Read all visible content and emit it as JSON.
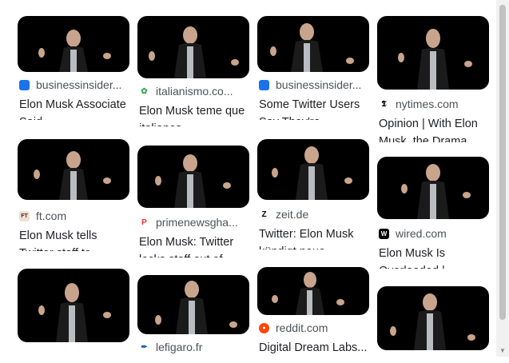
{
  "results": [
    {
      "source": "businessinsider...",
      "title": "Elon Musk Associate Said...",
      "favicon": "bi-icon",
      "favicon_color": "#1a73e8"
    },
    {
      "source": "italianismo.co...",
      "title": "Elon Musk teme que italianos...",
      "favicon": "it-leaf-icon",
      "favicon_color": "#34a853"
    },
    {
      "source": "businessinsider...",
      "title": "Some Twitter Users Say They're...",
      "favicon": "bi-icon",
      "favicon_color": "#1a73e8"
    },
    {
      "source": "nytimes.com",
      "title": "Opinion | With Elon Musk, the Drama...",
      "favicon": "nyt-icon",
      "favicon_color": "#000000"
    },
    {
      "source": "ft.com",
      "title": "Elon Musk tells Twitter staff to...",
      "favicon": "ft-icon",
      "favicon_color": "#f2dfce"
    },
    {
      "source": "primenewsgha...",
      "title": "Elon Musk: Twitter locks staff out of...",
      "favicon": "pn-icon",
      "favicon_color": "#e8322f"
    },
    {
      "source": "zeit.de",
      "title": "Twitter: Elon Musk kündigt neue...",
      "favicon": "zeit-icon",
      "favicon_color": "#000000"
    },
    {
      "source": "wired.com",
      "title": "Elon Musk Is Overloaded |...",
      "favicon": "wired-icon",
      "favicon_color": "#000000"
    },
    {
      "source": "",
      "title": "",
      "favicon": "",
      "favicon_color": ""
    },
    {
      "source": "lefigaro.fr",
      "title": "",
      "favicon": "figaro-icon",
      "favicon_color": "#1a5cb0"
    },
    {
      "source": "reddit.com",
      "title": "Digital Dream Labs...",
      "favicon": "reddit-icon",
      "favicon_color": "#ff4500"
    },
    {
      "source": "",
      "title": "",
      "favicon": "",
      "favicon_color": ""
    }
  ],
  "favicon_glyphs": {
    "bi-icon": "",
    "it-leaf-icon": "✿",
    "nyt-icon": "𝕿",
    "ft-icon": "FT",
    "pn-icon": "P",
    "zeit-icon": "Z",
    "wired-icon": "W",
    "figaro-icon": "✒",
    "reddit-icon": "●"
  }
}
